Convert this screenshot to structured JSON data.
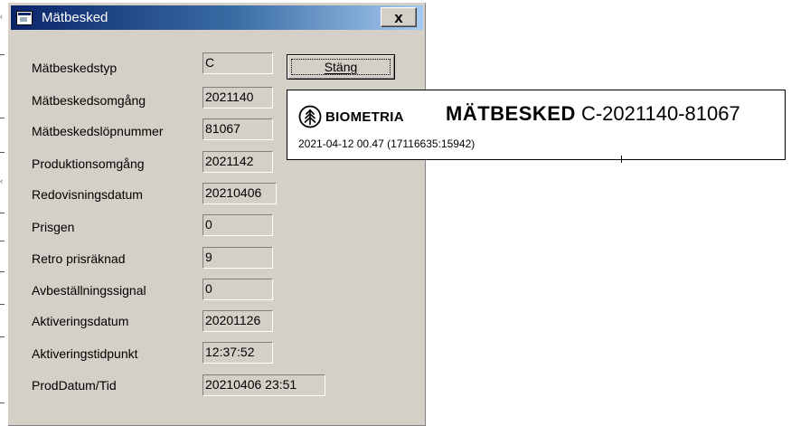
{
  "dialog": {
    "title": "Mätbesked",
    "close_glyph": "x",
    "close_button_label": "Stäng",
    "fields": [
      {
        "label": "Mätbeskedstyp",
        "value": "C"
      },
      {
        "label": "Mätbeskedsomgång",
        "value": "2021140"
      },
      {
        "label": "Mätbeskedslöpnummer",
        "value": "81067"
      },
      {
        "label": "Produktionsomgång",
        "value": "2021142"
      },
      {
        "label": "Redovisningsdatum",
        "value": "20210406"
      },
      {
        "label": "Prisgen",
        "value": "0"
      },
      {
        "label": "Retro prisräknad",
        "value": "9"
      },
      {
        "label": "Avbeställningssignal",
        "value": "0"
      },
      {
        "label": "Aktiveringsdatum",
        "value": "20201126"
      },
      {
        "label": "Aktiveringstidpunkt",
        "value": "12:37:52"
      },
      {
        "label": "ProdDatum/Tid",
        "value": "20210406 23:51"
      }
    ]
  },
  "report": {
    "brand": "BIOMETRIA",
    "title_bold": "MÄTBESKED",
    "title_id": "C-2021140-81067",
    "subtitle": "2021-04-12 00.47  (17116635:15942)"
  },
  "icons": {
    "window_icon": "form-window-icon",
    "logo_icon": "tree-circle-icon"
  }
}
